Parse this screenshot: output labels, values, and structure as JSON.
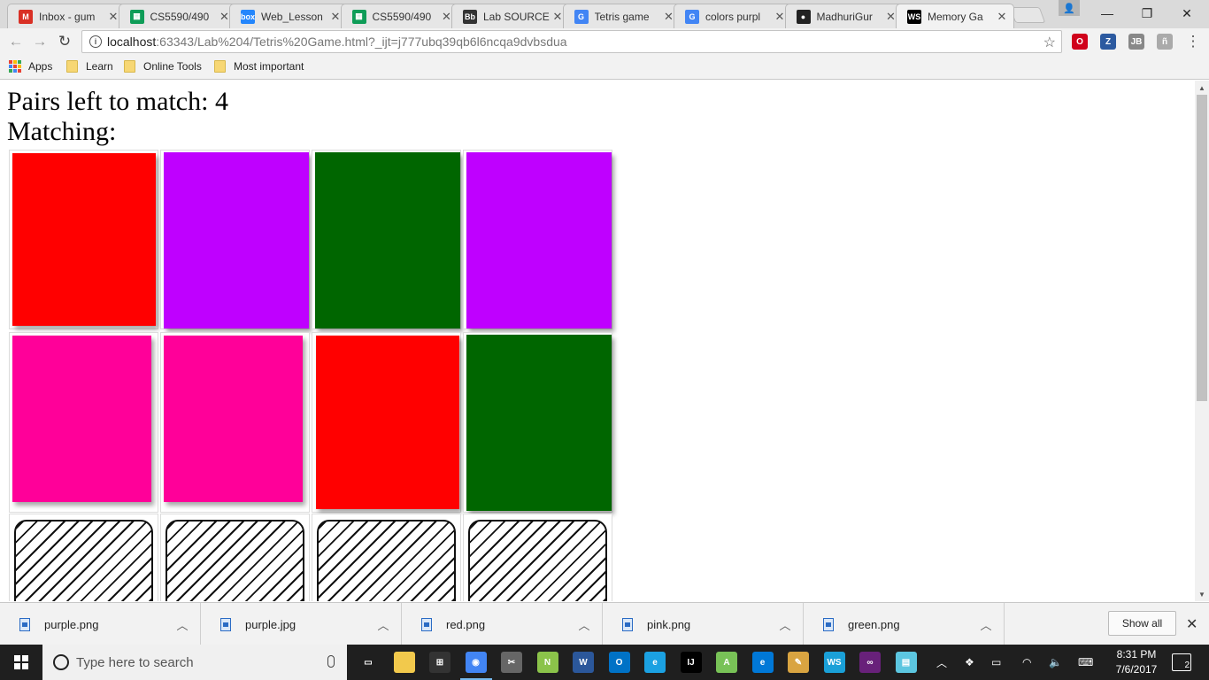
{
  "browser": {
    "tabs": [
      {
        "label": "Inbox - gum",
        "icon": "gmail-icon",
        "color": "#d93025",
        "glyph": "M"
      },
      {
        "label": "CS5590/490",
        "icon": "sheets-icon",
        "color": "#0f9d58",
        "glyph": "▦"
      },
      {
        "label": "Web_Lesson",
        "icon": "box-icon",
        "color": "#2486fc",
        "glyph": "box"
      },
      {
        "label": "CS5590/490",
        "icon": "sheets-icon",
        "color": "#0f9d58",
        "glyph": "▦"
      },
      {
        "label": "Lab SOURCE",
        "icon": "blackboard-icon",
        "color": "#333333",
        "glyph": "Bb"
      },
      {
        "label": "Tetris game",
        "icon": "google-icon",
        "color": "#4285f4",
        "glyph": "G"
      },
      {
        "label": "colors purpl",
        "icon": "google-icon",
        "color": "#4285f4",
        "glyph": "G"
      },
      {
        "label": "MadhuriGur",
        "icon": "github-icon",
        "color": "#222222",
        "glyph": "●"
      },
      {
        "label": "Memory Ga",
        "icon": "webstorm-icon",
        "color": "#000000",
        "glyph": "WS"
      }
    ],
    "url_host": "localhost",
    "url_path": ":63343/Lab%204/Tetris%20Game.html?_ijt=j777ubq39qb6l6ncqa9dvbsdua",
    "bookmarks": [
      {
        "label": "Apps"
      },
      {
        "label": "Learn"
      },
      {
        "label": "Online Tools"
      },
      {
        "label": "Most important"
      }
    ],
    "extensions": [
      {
        "icon": "opera-icon",
        "glyph": "O",
        "color": "#d0021b"
      },
      {
        "icon": "zotero-icon",
        "glyph": "Z",
        "color": "#2c5aa0"
      },
      {
        "icon": "jetbrains-icon",
        "glyph": "JB",
        "color": "#888888"
      },
      {
        "icon": "extension-icon",
        "glyph": "ñ",
        "color": "#aaaaaa"
      }
    ]
  },
  "page": {
    "pairs_label": "Pairs left to match: 4",
    "matching_label": "Matching:"
  },
  "cards": [
    {
      "row": 0,
      "col": 0,
      "state": "face-up",
      "color": "#ff0000"
    },
    {
      "row": 0,
      "col": 1,
      "state": "face-up",
      "color": "#bf00ff"
    },
    {
      "row": 0,
      "col": 2,
      "state": "face-up",
      "color": "#006600"
    },
    {
      "row": 0,
      "col": 3,
      "state": "face-up",
      "color": "#bf00ff"
    },
    {
      "row": 1,
      "col": 0,
      "state": "face-up",
      "color": "#ff0099"
    },
    {
      "row": 1,
      "col": 1,
      "state": "face-up",
      "color": "#ff0099"
    },
    {
      "row": 1,
      "col": 2,
      "state": "face-up",
      "color": "#ff0000"
    },
    {
      "row": 1,
      "col": 3,
      "state": "face-up",
      "color": "#006600"
    },
    {
      "row": 2,
      "col": 0,
      "state": "face-down"
    },
    {
      "row": 2,
      "col": 1,
      "state": "face-down"
    },
    {
      "row": 2,
      "col": 2,
      "state": "face-down"
    },
    {
      "row": 2,
      "col": 3,
      "state": "face-down"
    }
  ],
  "downloads": {
    "items": [
      {
        "name": "purple.png"
      },
      {
        "name": "purple.jpg"
      },
      {
        "name": "red.png"
      },
      {
        "name": "pink.png"
      },
      {
        "name": "green.png"
      }
    ],
    "show_all_label": "Show all"
  },
  "taskbar": {
    "search_placeholder": "Type here to search",
    "time": "8:31 PM",
    "date": "7/6/2017",
    "notifications": "2",
    "apps": [
      {
        "icon": "task-view-icon",
        "glyph": "▭",
        "color": "transparent"
      },
      {
        "icon": "file-explorer-icon",
        "glyph": "",
        "color": "#f2c94c"
      },
      {
        "icon": "store-icon",
        "glyph": "⊞",
        "color": "#333333"
      },
      {
        "icon": "chrome-icon",
        "glyph": "◉",
        "color": "#4285f4",
        "active": true
      },
      {
        "icon": "snipping-tool-icon",
        "glyph": "✂",
        "color": "#666666"
      },
      {
        "icon": "notepad-plus-icon",
        "glyph": "N",
        "color": "#8bc34a"
      },
      {
        "icon": "word-icon",
        "glyph": "W",
        "color": "#2b579a"
      },
      {
        "icon": "outlook-icon",
        "glyph": "O",
        "color": "#0072c6"
      },
      {
        "icon": "internet-explorer-icon",
        "glyph": "e",
        "color": "#1ba1e2"
      },
      {
        "icon": "intellij-icon",
        "glyph": "IJ",
        "color": "#000000"
      },
      {
        "icon": "android-studio-icon",
        "glyph": "A",
        "color": "#78c257"
      },
      {
        "icon": "edge-icon",
        "glyph": "e",
        "color": "#0078d7"
      },
      {
        "icon": "paint-icon",
        "glyph": "✎",
        "color": "#d9a441"
      },
      {
        "icon": "webstorm-taskbar-icon",
        "glyph": "WS",
        "color": "#1aa0d8"
      },
      {
        "icon": "visual-studio-icon",
        "glyph": "∞",
        "color": "#68217a"
      },
      {
        "icon": "notes-icon",
        "glyph": "▤",
        "color": "#5cc6e0"
      }
    ]
  }
}
